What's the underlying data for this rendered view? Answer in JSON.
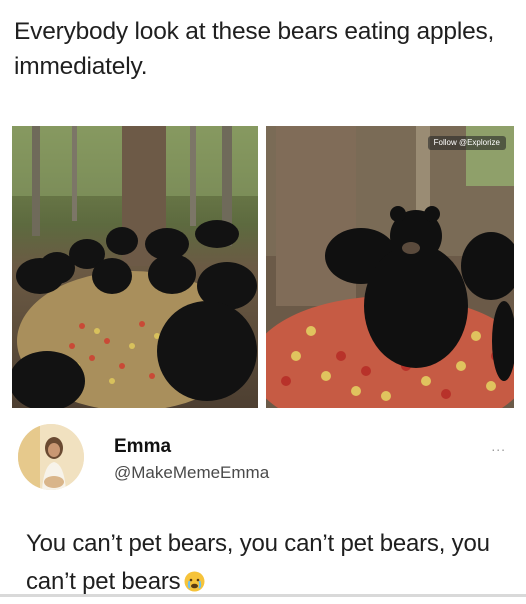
{
  "headline": "Everybody look at these bears eating apples, immediately.",
  "photos": {
    "left_icon": "bears-eating-apples-photo",
    "right_icon": "bear-sitting-in-apples-photo",
    "watermark": "Follow @Explorize"
  },
  "post": {
    "display_name": "Emma",
    "handle": "@MakeMemeEmma",
    "more": "...",
    "body": "You can’t pet bears, you can’t pet bears, you can’t pet bears",
    "emoji_icon": "crying-face-icon"
  }
}
